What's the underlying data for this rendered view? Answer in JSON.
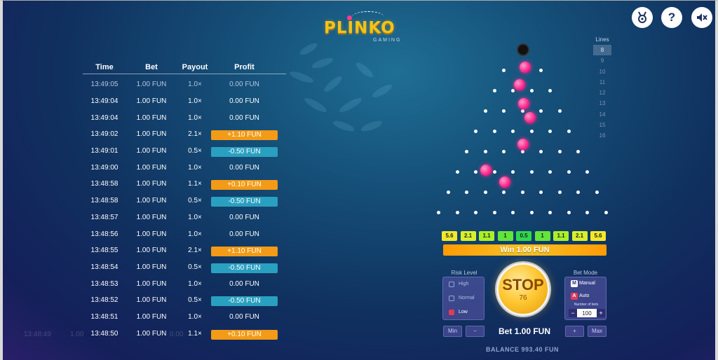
{
  "logo": {
    "title": "PLINKO",
    "subtitle": "GAMING"
  },
  "top_icons": [
    "medal-icon",
    "help-icon",
    "mute-icon"
  ],
  "history": {
    "headers": {
      "time": "Time",
      "bet": "Bet",
      "payout": "Payout",
      "profit": "Profit"
    },
    "rows": [
      {
        "time": "13:49:05",
        "bet": "1.00 FUN",
        "payout": "1.0×",
        "profit": "0.00 FUN",
        "status": "neutral"
      },
      {
        "time": "13:49:04",
        "bet": "1.00 FUN",
        "payout": "1.0×",
        "profit": "0.00 FUN",
        "status": "neutral"
      },
      {
        "time": "13:49:04",
        "bet": "1.00 FUN",
        "payout": "1.0×",
        "profit": "0.00 FUN",
        "status": "neutral"
      },
      {
        "time": "13:49:02",
        "bet": "1.00 FUN",
        "payout": "2.1×",
        "profit": "+1.10 FUN",
        "status": "win"
      },
      {
        "time": "13:49:01",
        "bet": "1.00 FUN",
        "payout": "0.5×",
        "profit": "-0.50 FUN",
        "status": "lose"
      },
      {
        "time": "13:49:00",
        "bet": "1.00 FUN",
        "payout": "1.0×",
        "profit": "0.00 FUN",
        "status": "neutral"
      },
      {
        "time": "13:48:58",
        "bet": "1.00 FUN",
        "payout": "1.1×",
        "profit": "+0.10 FUN",
        "status": "win"
      },
      {
        "time": "13:48:58",
        "bet": "1.00 FUN",
        "payout": "0.5×",
        "profit": "-0.50 FUN",
        "status": "lose"
      },
      {
        "time": "13:48:57",
        "bet": "1.00 FUN",
        "payout": "1.0×",
        "profit": "0.00 FUN",
        "status": "neutral"
      },
      {
        "time": "13:48:56",
        "bet": "1.00 FUN",
        "payout": "1.0×",
        "profit": "0.00 FUN",
        "status": "neutral"
      },
      {
        "time": "13:48:55",
        "bet": "1.00 FUN",
        "payout": "2.1×",
        "profit": "+1.10 FUN",
        "status": "win"
      },
      {
        "time": "13:48:54",
        "bet": "1.00 FUN",
        "payout": "0.5×",
        "profit": "-0.50 FUN",
        "status": "lose"
      },
      {
        "time": "13:48:53",
        "bet": "1.00 FUN",
        "payout": "1.0×",
        "profit": "0.00 FUN",
        "status": "neutral"
      },
      {
        "time": "13:48:52",
        "bet": "1.00 FUN",
        "payout": "0.5×",
        "profit": "-0.50 FUN",
        "status": "lose"
      },
      {
        "time": "13:48:51",
        "bet": "1.00 FUN",
        "payout": "1.0×",
        "profit": "0.00 FUN",
        "status": "neutral"
      },
      {
        "time": "13:48:50",
        "bet": "1.00 FUN",
        "payout": "1.1×",
        "profit": "+0.10 FUN",
        "status": "win"
      }
    ],
    "ghost_row": {
      "time": "13:48:49",
      "bet": "1.00",
      "profit": "0.00"
    }
  },
  "lines": {
    "title": "Lines",
    "options": [
      "8",
      "9",
      "10",
      "11",
      "12",
      "13",
      "14",
      "15",
      "16"
    ],
    "selected": "8"
  },
  "multipliers": [
    {
      "label": "5.6",
      "color": "#f2e92b"
    },
    {
      "label": "2.1",
      "color": "#d8f02b"
    },
    {
      "label": "1.1",
      "color": "#a8f028"
    },
    {
      "label": "1",
      "color": "#62e63a"
    },
    {
      "label": "0.5",
      "color": "#2fd84c"
    },
    {
      "label": "1",
      "color": "#62e63a"
    },
    {
      "label": "1.1",
      "color": "#a8f028"
    },
    {
      "label": "2.1",
      "color": "#d8f02b"
    },
    {
      "label": "5.6",
      "color": "#f2e92b"
    }
  ],
  "win_banner": "Win 1.00 FUN",
  "risk": {
    "title": "Risk Level",
    "options": [
      "High",
      "Normal",
      "Low"
    ],
    "selected": "Low"
  },
  "bet_mode": {
    "title": "Bet Mode",
    "manual": "Manual",
    "auto": "Auto",
    "bets_label": "Number of bets",
    "bets_value": "100",
    "minus": "−",
    "plus": "+"
  },
  "stop": {
    "label": "STOP",
    "count": "76"
  },
  "bet_controls": {
    "min": "Min",
    "minus": "−",
    "plus": "+",
    "max": "Max"
  },
  "bet_amount": "Bet 1.00 FUN",
  "balance": "BALANCE 993.40 FUN",
  "colors": {
    "win": "#f39a16",
    "lose": "#2aa0c0",
    "logo": "#f5c21b",
    "ball": "#ff2a8d"
  }
}
